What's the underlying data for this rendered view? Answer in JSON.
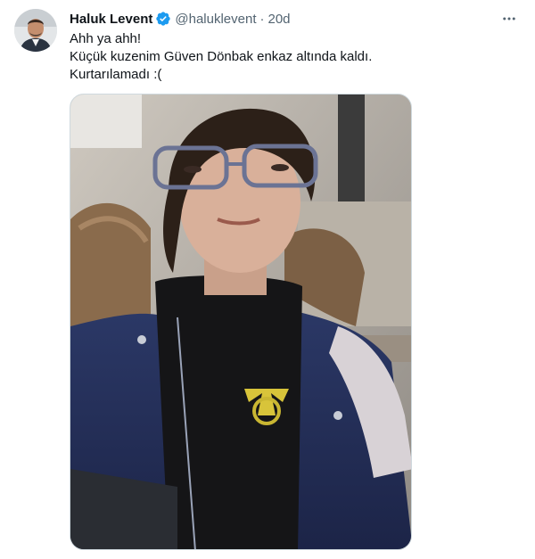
{
  "tweet": {
    "author": {
      "display_name": "Haluk Levent",
      "handle": "@haluklevent",
      "verified": true,
      "avatar_icon": "profile-avatar"
    },
    "separator": "·",
    "timestamp": "20d",
    "more_icon": "more-options-icon",
    "text_lines": [
      "Ahh ya ahh!",
      "Küçük kuzenim Güven Dönbak enkaz altında kaldı.",
      "Kurtarılamadı :("
    ],
    "media": {
      "type": "photo",
      "description_icon": "tweet-photo"
    }
  },
  "colors": {
    "text_primary": "#0f1419",
    "text_secondary": "#536471",
    "verified_blue": "#1d9bf0",
    "border": "#cfd9de"
  }
}
